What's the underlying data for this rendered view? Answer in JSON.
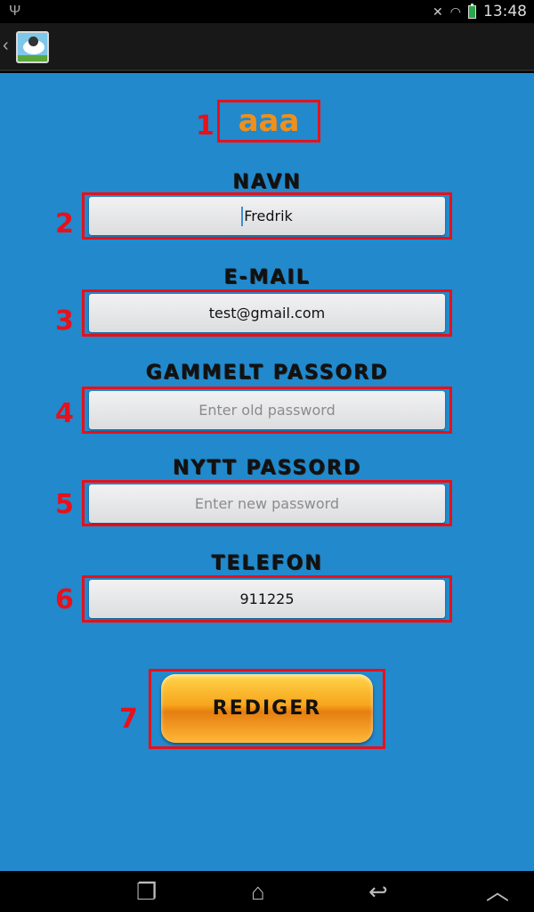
{
  "status_bar": {
    "time": "13:48",
    "icons": [
      "usb-icon",
      "mute-icon",
      "wifi-icon",
      "battery-icon"
    ]
  },
  "action_bar": {
    "icons": [
      "back-chevron-icon",
      "app-sheep-icon"
    ]
  },
  "header": {
    "username": "aaa"
  },
  "form": {
    "name_label": "NAVN",
    "name_value": "Fredrik",
    "email_label": "E-MAIL",
    "email_value": "test@gmail.com",
    "old_password_label": "GAMMELT PASSORD",
    "old_password_placeholder": "Enter old password",
    "new_password_label": "NYTT PASSORD",
    "new_password_placeholder": "Enter new password",
    "phone_label": "TELEFON",
    "phone_value": "911225",
    "submit_label": "REDIGER"
  },
  "annotations": [
    "1",
    "2",
    "3",
    "4",
    "5",
    "6",
    "7"
  ],
  "colors": {
    "background": "#2189cc",
    "title_color": "#f0901a",
    "annotation_red": "#e8101a",
    "button_orange": "#f7a51d"
  },
  "nav_bar": {
    "icons": [
      "recent-apps-icon",
      "home-icon",
      "back-icon",
      "menu-up-icon"
    ]
  }
}
